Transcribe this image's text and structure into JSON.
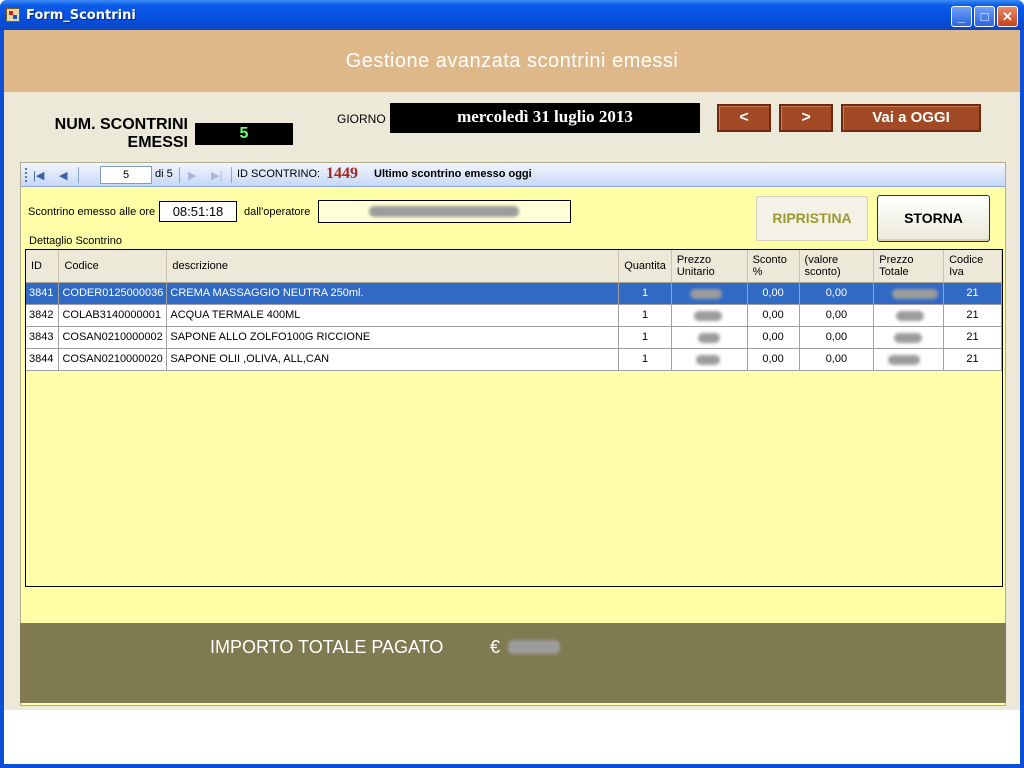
{
  "window": {
    "title": "Form_Scontrini",
    "minimize": "_",
    "maximize": "□",
    "close": "✕"
  },
  "header": {
    "title": "Gestione avanzata scontrini emessi"
  },
  "summary": {
    "num_label_line1": "NUM. SCONTRINI",
    "num_label_line2": "EMESSI",
    "num_value": "5",
    "giorno_label": "GIORNO",
    "date": "mercoledì 31 luglio 2013",
    "prev_label": "<",
    "next_label": ">",
    "today_label": "Vai a OGGI"
  },
  "navigator": {
    "position": "5",
    "of_text": "di 5",
    "id_label": "ID SCONTRINO:",
    "id_value": "1449",
    "message": "Ultimo scontrino emesso oggi"
  },
  "receipt": {
    "emesso_label": "Scontrino emesso alle ore",
    "time": "08:51:18",
    "operator_label": "dall'operatore",
    "ripristina_label": "RIPRISTINA",
    "storna_label": "STORNA",
    "dettaglio_label": "Dettaglio Scontrino"
  },
  "table": {
    "headers": [
      "ID",
      "Codice",
      "descrizione",
      "Quantita",
      "Prezzo Unitario",
      "Sconto %",
      "(valore sconto)",
      "Prezzo Totale",
      "Codice Iva"
    ],
    "rows": [
      {
        "id": "3841",
        "codice": "CODER0125000036",
        "descrizione": "CREMA MASSAGGIO NEUTRA 250ml.",
        "quantita": "1",
        "sconto": "0,00",
        "valore_sconto": "0,00",
        "iva": "21"
      },
      {
        "id": "3842",
        "codice": "COLAB3140000001",
        "descrizione": "ACQUA TERMALE 400ML",
        "quantita": "1",
        "sconto": "0,00",
        "valore_sconto": "0,00",
        "iva": "21"
      },
      {
        "id": "3843",
        "codice": "COSAN0210000002",
        "descrizione": "SAPONE ALLO ZOLFO100G RICCIONE",
        "quantita": "1",
        "sconto": "0,00",
        "valore_sconto": "0,00",
        "iva": "21"
      },
      {
        "id": "3844",
        "codice": "COSAN0210000020",
        "descrizione": "SAPONE OLII ,OLIVA, ALL,CAN",
        "quantita": "1",
        "sconto": "0,00",
        "valore_sconto": "0,00",
        "iva": "21"
      }
    ]
  },
  "total": {
    "label": "IMPORTO TOTALE PAGATO",
    "currency": "€"
  },
  "colors": {
    "header_band": "#dfb88a",
    "panel": "#ffffa8",
    "total_band": "#7f7a50",
    "nav_button": "#a24a26",
    "selection": "#316ac5"
  }
}
